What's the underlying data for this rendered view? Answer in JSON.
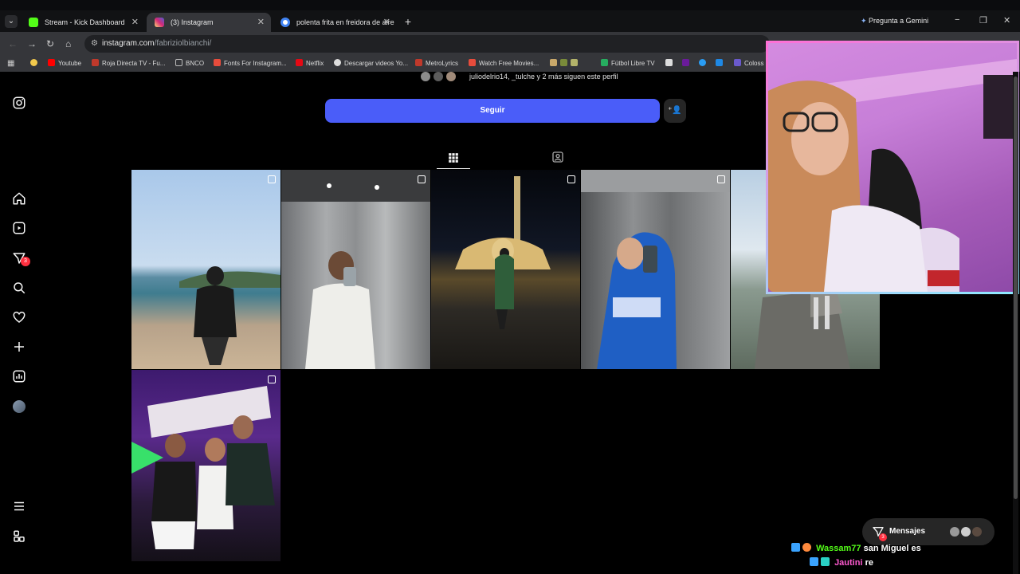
{
  "browser": {
    "tabs": [
      {
        "title": "Stream - Kick Dashboard",
        "favicon_color": "#53fc18"
      },
      {
        "title": "(3) Instagram",
        "favicon_color": "#d6249f"
      },
      {
        "title": "polenta frita en freidora de aire",
        "favicon_color": "#4285f4"
      }
    ],
    "new_tab": "+",
    "gemini": "Pregunta a Gemini",
    "window_controls": [
      "−",
      "❐",
      "✕"
    ],
    "url_host": "instagram.com",
    "url_path": "/fabriziolbianchi/",
    "bookmarks": [
      {
        "label": "",
        "color": "#f2c94c"
      },
      {
        "label": "Youtube",
        "color": "#ff0000"
      },
      {
        "label": "Roja Directa TV - Fu...",
        "color": "#c0392b"
      },
      {
        "label": "BNCO",
        "color": "#888888"
      },
      {
        "label": "Fonts For Instagram...",
        "color": "#e74c3c"
      },
      {
        "label": "Netflix",
        "color": "#e50914"
      },
      {
        "label": "Descargar videos Yo...",
        "color": "#dddddd"
      },
      {
        "label": "MetroLyrics",
        "color": "#c0392b"
      },
      {
        "label": "Watch Free Movies...",
        "color": "#e74c3c"
      },
      {
        "label": "Fútbol Libre TV",
        "color": "#27ae60"
      },
      {
        "label": "Coloss",
        "color": "#6a5acd"
      }
    ]
  },
  "profile": {
    "followed_by": "juliodelrio14, _tulche y 2 más siguen este perfil",
    "follow_label": "Seguir",
    "accent": "#4a5df9"
  },
  "sidebar": {
    "notifications_badge": "3"
  },
  "posts": [
    {
      "scene": "beach",
      "multi": true
    },
    {
      "scene": "elevator-mirror",
      "multi": true
    },
    {
      "scene": "vatican-night",
      "multi": true
    },
    {
      "scene": "blue-hoodie",
      "multi": true
    },
    {
      "scene": "rock-landscape",
      "multi": false
    },
    {
      "scene": "party-group",
      "multi": true
    }
  ],
  "messages": {
    "label": "Mensajes",
    "badge": "3"
  },
  "chat": [
    {
      "user": "Wassam77",
      "user_color": "#53fc18",
      "text": "san Miguel es"
    },
    {
      "user": "Jautini",
      "user_color": "#ff5ad0",
      "text": "re"
    }
  ]
}
